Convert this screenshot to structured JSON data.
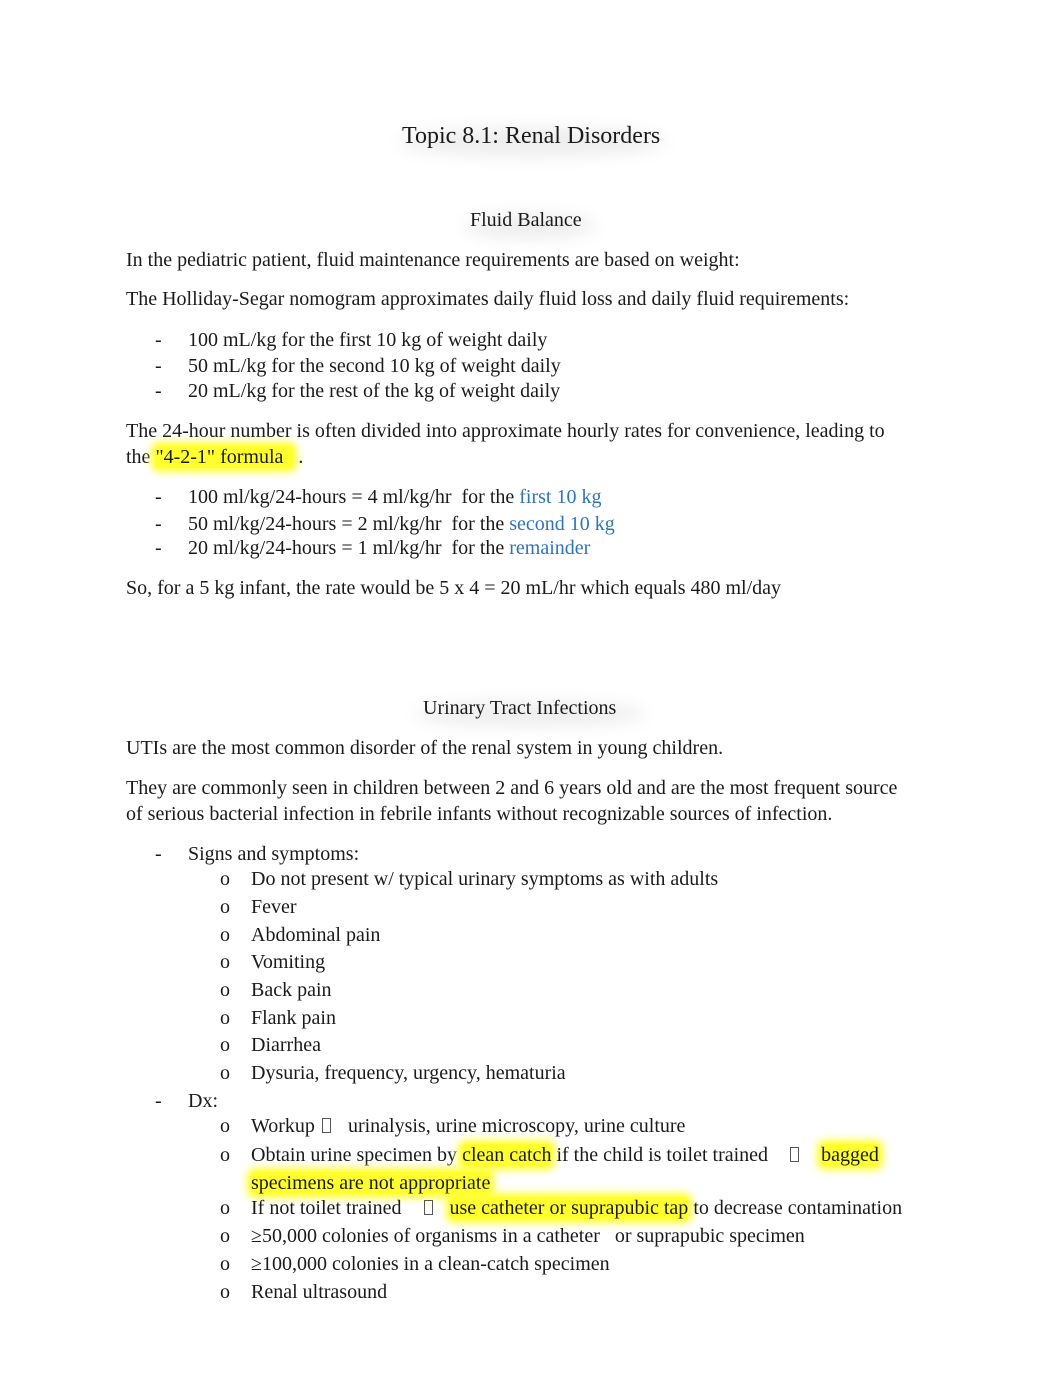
{
  "document": {
    "title": "Topic 8.1: Renal Disorders",
    "sections": {
      "fluid_balance": {
        "heading": "Fluid Balance",
        "p1": "In the pediatric patient, fluid maintenance requirements are based on weight:",
        "p2": "The Holliday-Segar nomogram approximates daily fluid loss and daily fluid requirements:",
        "list1": [
          "100 mL/kg  for the first 10 kg  of weight daily",
          "50 mL/kg  for the second 10 kg  of weight daily",
          "20 mL/kg  for the rest  of the kg of weight daily"
        ],
        "p3_line1": "The 24-hour number is often divided into approximate hourly rates for convenience, leading to",
        "p3_line2_pre": "the ",
        "p3_highlight": "\"4-2-1\" formula  ",
        "p3_line2_post": " .",
        "list2": [
          {
            "text": "100 ml/kg/24-hours = 4 ml/kg/hr  for the ",
            "blue": "first 10 kg"
          },
          {
            "text": "50 ml/kg/24-hours = 2 ml/kg/hr  for the ",
            "blue": "second 10 kg"
          },
          {
            "text": "20 ml/kg/24-hours = 1 ml/kg/hr  for the ",
            "blue": "remainder"
          }
        ],
        "p4": "So, for a 5 kg infant, the rate would be 5 x 4 = 20 mL/hr which equals 480 ml/day"
      },
      "uti": {
        "heading": "Urinary Tract Infections",
        "p1": "UTIs are the most common disorder of the renal system in young children.",
        "p2_line1": "They are commonly seen in children between 2 and 6 years old and are the most frequent source",
        "p2_line2": "of serious bacterial infection in febrile infants without recognizable sources of infection.",
        "signs_label": "Signs and symptoms:",
        "signs": [
          "Do not present w/ typical urinary symptoms as with adults",
          "Fever",
          "Abdominal pain",
          "Vomiting",
          "Back pain",
          "Flank pain",
          "Diarrhea",
          "Dysuria, frequency, urgency, hematuria"
        ],
        "dx_label": "Dx:",
        "dx": {
          "workup_pre": "Workup",
          "workup_post": "urinalysis, urine microscopy, urine culture",
          "obtain_pre": "Obtain urine specimen by ",
          "obtain_hl1": "clean catch",
          "obtain_mid": " if the child is toilet trained",
          "obtain_hl2a": "bagged",
          "obtain_hl2b": "specimens are not appropriate",
          "notoilet_pre": "If not toilet trained",
          "notoilet_hl": "use catheter or suprapubic tap",
          "notoilet_post": " to decrease contamination",
          "item4": "≥50,000 colonies of organisms in a catheter   or suprapubic specimen",
          "item5": "≥100,000 colonies in a clean-catch specimen",
          "item6": "Renal ultrasound"
        }
      }
    },
    "bullets": {
      "dash": "-",
      "circle": "o"
    },
    "colors": {
      "highlight": "#ffff2e",
      "link_blue": "#2e75b6",
      "text": "#1a1a1a"
    }
  }
}
